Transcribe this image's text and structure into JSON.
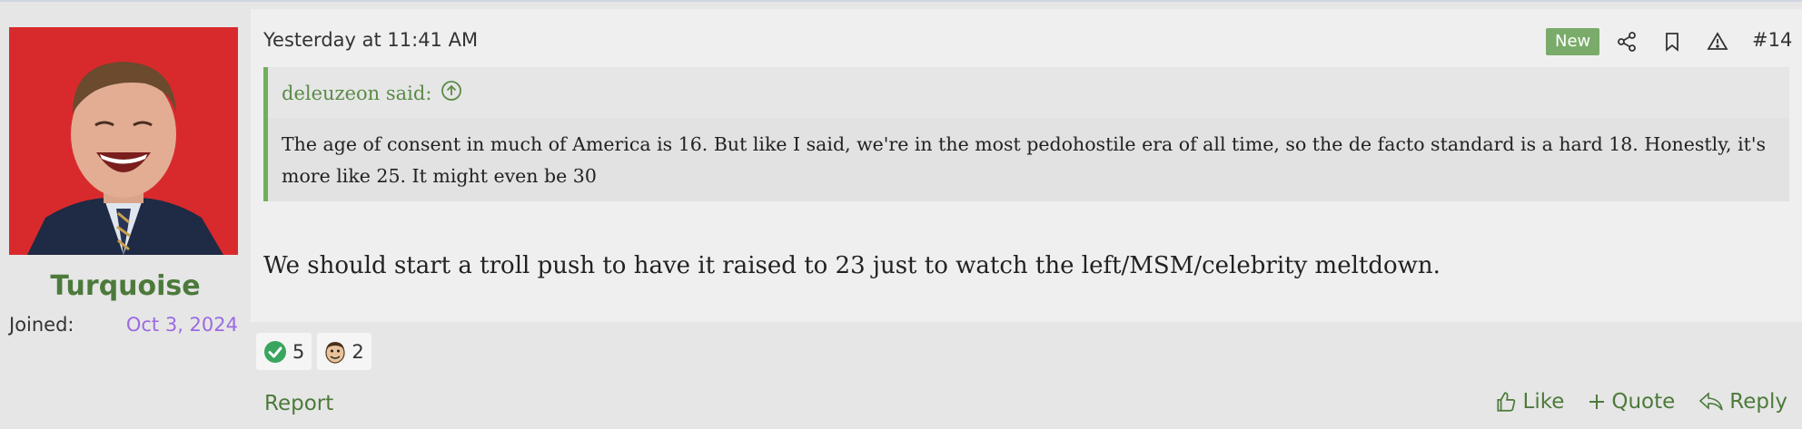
{
  "post": {
    "timestamp": "Yesterday at 11:41 AM",
    "badge": "New",
    "number": "#14",
    "icons": [
      "share-icon",
      "bookmark-icon",
      "report-warning-icon"
    ]
  },
  "user": {
    "name": "Turquoise",
    "joined_label": "Joined:",
    "joined_value": "Oct 3, 2024"
  },
  "quote": {
    "author_said": "deleuzeon said:",
    "text": "The age of consent in much of America is 16. But like I said, we're in the most pedohostile era of all time, so the de facto standard is a hard 18. Honestly, it's more like 25. It might even be 30"
  },
  "message": "We should start a troll push to have it raised to 23 just to watch the left/MSM/celebrity meltdown.",
  "reactions": [
    {
      "icon": "check-icon",
      "count": "5"
    },
    {
      "icon": "face-icon",
      "count": "2"
    }
  ],
  "actions": {
    "report": "Report",
    "like": "Like",
    "quote": "Quote",
    "reply": "Reply"
  },
  "colors": {
    "accent_green": "#4c7a3b",
    "quote_border": "#6fb05a",
    "badge_bg": "#7aab6a",
    "joined_date": "#9c6ae0"
  }
}
